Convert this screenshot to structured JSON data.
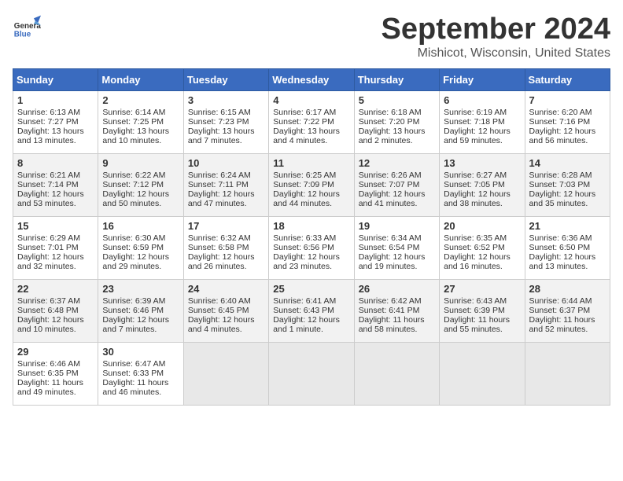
{
  "header": {
    "logo_line1": "General",
    "logo_line2": "Blue",
    "month": "September 2024",
    "location": "Mishicot, Wisconsin, United States"
  },
  "weekdays": [
    "Sunday",
    "Monday",
    "Tuesday",
    "Wednesday",
    "Thursday",
    "Friday",
    "Saturday"
  ],
  "weeks": [
    [
      {
        "day": "1",
        "lines": [
          "Sunrise: 6:13 AM",
          "Sunset: 7:27 PM",
          "Daylight: 13 hours",
          "and 13 minutes."
        ]
      },
      {
        "day": "2",
        "lines": [
          "Sunrise: 6:14 AM",
          "Sunset: 7:25 PM",
          "Daylight: 13 hours",
          "and 10 minutes."
        ]
      },
      {
        "day": "3",
        "lines": [
          "Sunrise: 6:15 AM",
          "Sunset: 7:23 PM",
          "Daylight: 13 hours",
          "and 7 minutes."
        ]
      },
      {
        "day": "4",
        "lines": [
          "Sunrise: 6:17 AM",
          "Sunset: 7:22 PM",
          "Daylight: 13 hours",
          "and 4 minutes."
        ]
      },
      {
        "day": "5",
        "lines": [
          "Sunrise: 6:18 AM",
          "Sunset: 7:20 PM",
          "Daylight: 13 hours",
          "and 2 minutes."
        ]
      },
      {
        "day": "6",
        "lines": [
          "Sunrise: 6:19 AM",
          "Sunset: 7:18 PM",
          "Daylight: 12 hours",
          "and 59 minutes."
        ]
      },
      {
        "day": "7",
        "lines": [
          "Sunrise: 6:20 AM",
          "Sunset: 7:16 PM",
          "Daylight: 12 hours",
          "and 56 minutes."
        ]
      }
    ],
    [
      {
        "day": "8",
        "lines": [
          "Sunrise: 6:21 AM",
          "Sunset: 7:14 PM",
          "Daylight: 12 hours",
          "and 53 minutes."
        ]
      },
      {
        "day": "9",
        "lines": [
          "Sunrise: 6:22 AM",
          "Sunset: 7:12 PM",
          "Daylight: 12 hours",
          "and 50 minutes."
        ]
      },
      {
        "day": "10",
        "lines": [
          "Sunrise: 6:24 AM",
          "Sunset: 7:11 PM",
          "Daylight: 12 hours",
          "and 47 minutes."
        ]
      },
      {
        "day": "11",
        "lines": [
          "Sunrise: 6:25 AM",
          "Sunset: 7:09 PM",
          "Daylight: 12 hours",
          "and 44 minutes."
        ]
      },
      {
        "day": "12",
        "lines": [
          "Sunrise: 6:26 AM",
          "Sunset: 7:07 PM",
          "Daylight: 12 hours",
          "and 41 minutes."
        ]
      },
      {
        "day": "13",
        "lines": [
          "Sunrise: 6:27 AM",
          "Sunset: 7:05 PM",
          "Daylight: 12 hours",
          "and 38 minutes."
        ]
      },
      {
        "day": "14",
        "lines": [
          "Sunrise: 6:28 AM",
          "Sunset: 7:03 PM",
          "Daylight: 12 hours",
          "and 35 minutes."
        ]
      }
    ],
    [
      {
        "day": "15",
        "lines": [
          "Sunrise: 6:29 AM",
          "Sunset: 7:01 PM",
          "Daylight: 12 hours",
          "and 32 minutes."
        ]
      },
      {
        "day": "16",
        "lines": [
          "Sunrise: 6:30 AM",
          "Sunset: 6:59 PM",
          "Daylight: 12 hours",
          "and 29 minutes."
        ]
      },
      {
        "day": "17",
        "lines": [
          "Sunrise: 6:32 AM",
          "Sunset: 6:58 PM",
          "Daylight: 12 hours",
          "and 26 minutes."
        ]
      },
      {
        "day": "18",
        "lines": [
          "Sunrise: 6:33 AM",
          "Sunset: 6:56 PM",
          "Daylight: 12 hours",
          "and 23 minutes."
        ]
      },
      {
        "day": "19",
        "lines": [
          "Sunrise: 6:34 AM",
          "Sunset: 6:54 PM",
          "Daylight: 12 hours",
          "and 19 minutes."
        ]
      },
      {
        "day": "20",
        "lines": [
          "Sunrise: 6:35 AM",
          "Sunset: 6:52 PM",
          "Daylight: 12 hours",
          "and 16 minutes."
        ]
      },
      {
        "day": "21",
        "lines": [
          "Sunrise: 6:36 AM",
          "Sunset: 6:50 PM",
          "Daylight: 12 hours",
          "and 13 minutes."
        ]
      }
    ],
    [
      {
        "day": "22",
        "lines": [
          "Sunrise: 6:37 AM",
          "Sunset: 6:48 PM",
          "Daylight: 12 hours",
          "and 10 minutes."
        ]
      },
      {
        "day": "23",
        "lines": [
          "Sunrise: 6:39 AM",
          "Sunset: 6:46 PM",
          "Daylight: 12 hours",
          "and 7 minutes."
        ]
      },
      {
        "day": "24",
        "lines": [
          "Sunrise: 6:40 AM",
          "Sunset: 6:45 PM",
          "Daylight: 12 hours",
          "and 4 minutes."
        ]
      },
      {
        "day": "25",
        "lines": [
          "Sunrise: 6:41 AM",
          "Sunset: 6:43 PM",
          "Daylight: 12 hours",
          "and 1 minute."
        ]
      },
      {
        "day": "26",
        "lines": [
          "Sunrise: 6:42 AM",
          "Sunset: 6:41 PM",
          "Daylight: 11 hours",
          "and 58 minutes."
        ]
      },
      {
        "day": "27",
        "lines": [
          "Sunrise: 6:43 AM",
          "Sunset: 6:39 PM",
          "Daylight: 11 hours",
          "and 55 minutes."
        ]
      },
      {
        "day": "28",
        "lines": [
          "Sunrise: 6:44 AM",
          "Sunset: 6:37 PM",
          "Daylight: 11 hours",
          "and 52 minutes."
        ]
      }
    ],
    [
      {
        "day": "29",
        "lines": [
          "Sunrise: 6:46 AM",
          "Sunset: 6:35 PM",
          "Daylight: 11 hours",
          "and 49 minutes."
        ]
      },
      {
        "day": "30",
        "lines": [
          "Sunrise: 6:47 AM",
          "Sunset: 6:33 PM",
          "Daylight: 11 hours",
          "and 46 minutes."
        ]
      },
      {
        "day": "",
        "lines": []
      },
      {
        "day": "",
        "lines": []
      },
      {
        "day": "",
        "lines": []
      },
      {
        "day": "",
        "lines": []
      },
      {
        "day": "",
        "lines": []
      }
    ]
  ]
}
